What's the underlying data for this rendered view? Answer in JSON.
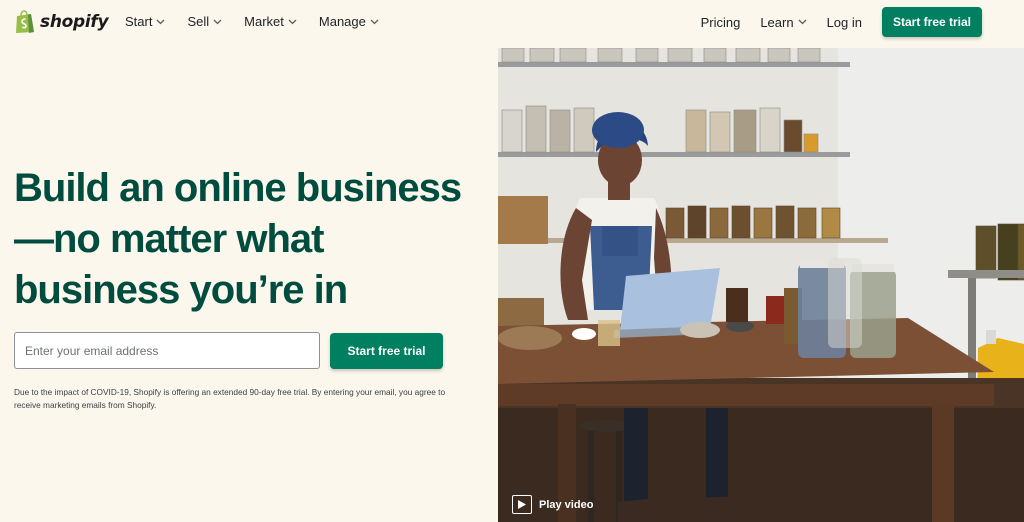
{
  "brand": {
    "name": "shopify",
    "accent": "#008060",
    "headline_color": "#004c3f",
    "background": "#fbf7ed"
  },
  "nav": {
    "left": [
      {
        "label": "Start",
        "icon": "chevron-down-icon"
      },
      {
        "label": "Sell",
        "icon": "chevron-down-icon"
      },
      {
        "label": "Market",
        "icon": "chevron-down-icon"
      },
      {
        "label": "Manage",
        "icon": "chevron-down-icon"
      }
    ],
    "pricing": "Pricing",
    "learn": "Learn",
    "login": "Log in",
    "cta": "Start free trial"
  },
  "hero": {
    "headline": "Build an online business—no matter what business you’re in",
    "email_placeholder": "Enter your email address",
    "cta": "Start free trial",
    "disclaimer": "Due to the impact of COVID-19, Shopify is offering an extended 90-day free trial. By entering your email, you agree to receive marketing emails from Shopify.",
    "play_label": "Play video"
  }
}
